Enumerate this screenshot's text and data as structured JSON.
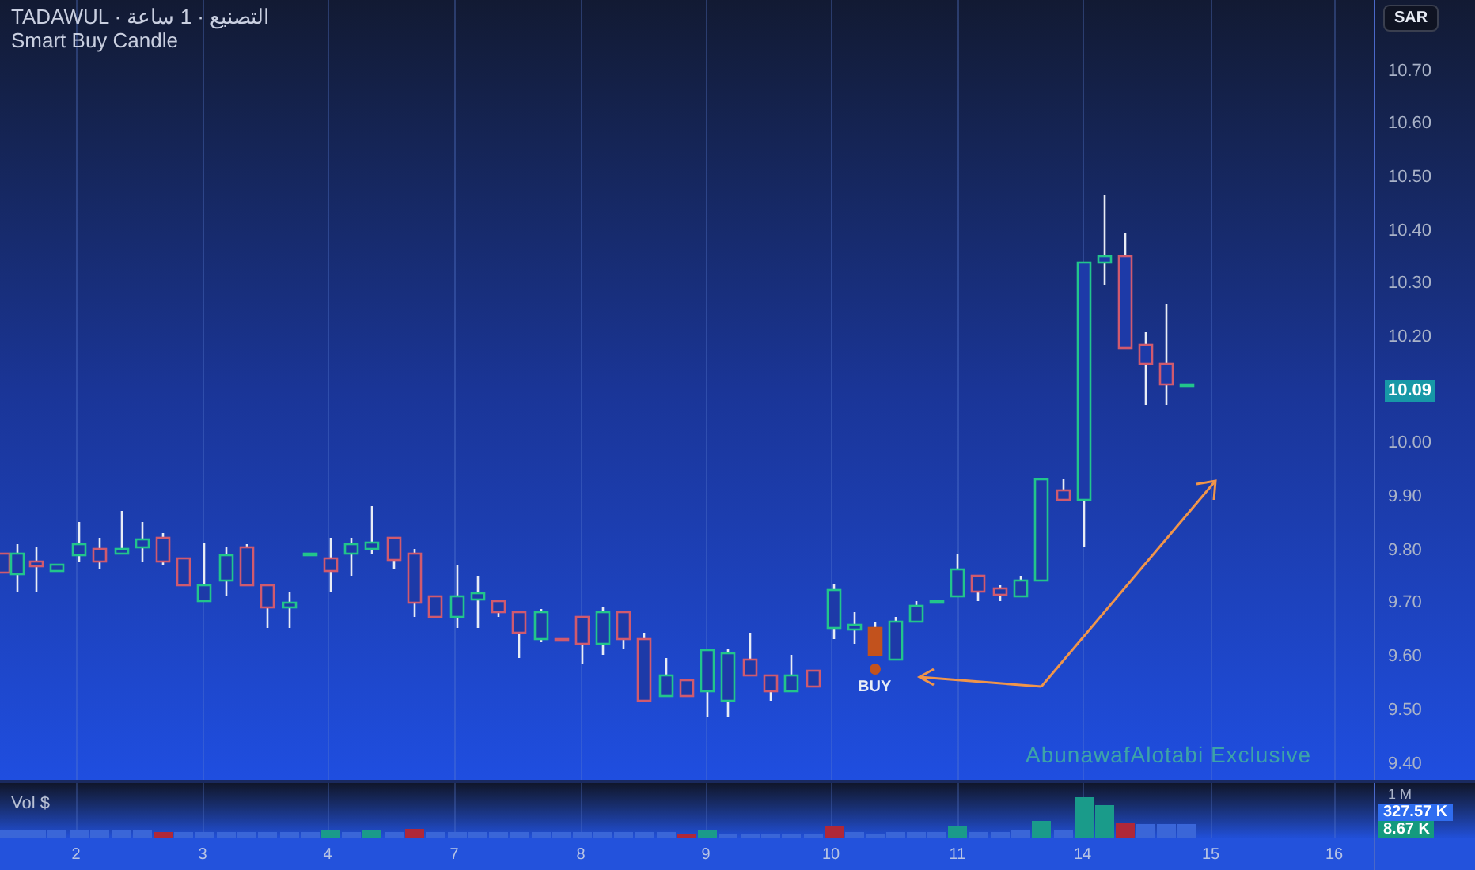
{
  "header": {
    "symbol_line": "TADAWUL · التصنيع · 1 ساعة",
    "indicator": "Smart Buy Candle"
  },
  "currency_button": "SAR",
  "price_axis": [
    {
      "kind": "tick",
      "text": "10.70"
    },
    {
      "kind": "tick",
      "text": "10.60"
    },
    {
      "kind": "tick",
      "text": "10.50"
    },
    {
      "kind": "tick",
      "text": "10.40"
    },
    {
      "kind": "tick",
      "text": "10.30"
    },
    {
      "kind": "tick",
      "text": "10.20"
    },
    {
      "kind": "price_tag",
      "text": "10.09"
    },
    {
      "kind": "tick",
      "text": "10.00"
    },
    {
      "kind": "tick",
      "text": "9.90"
    },
    {
      "kind": "tick",
      "text": "9.80"
    },
    {
      "kind": "tick",
      "text": "9.70"
    },
    {
      "kind": "tick",
      "text": "9.60"
    },
    {
      "kind": "tick",
      "text": "9.50"
    },
    {
      "kind": "tick",
      "text": "9.40"
    }
  ],
  "chart": {
    "buy_label": "BUY",
    "signature": "AbunawafAlotabi Exclusive"
  },
  "volume_pane": {
    "label": "Vol $",
    "axis": [
      {
        "kind": "tick",
        "text": "1 M"
      },
      {
        "kind": "tag_blue",
        "text": "327.57 K"
      },
      {
        "kind": "tag_green",
        "text": "8.67 K"
      }
    ]
  },
  "time_axis": [
    "2",
    "3",
    "4",
    "7",
    "8",
    "9",
    "10",
    "11",
    "14",
    "15",
    "16"
  ]
}
